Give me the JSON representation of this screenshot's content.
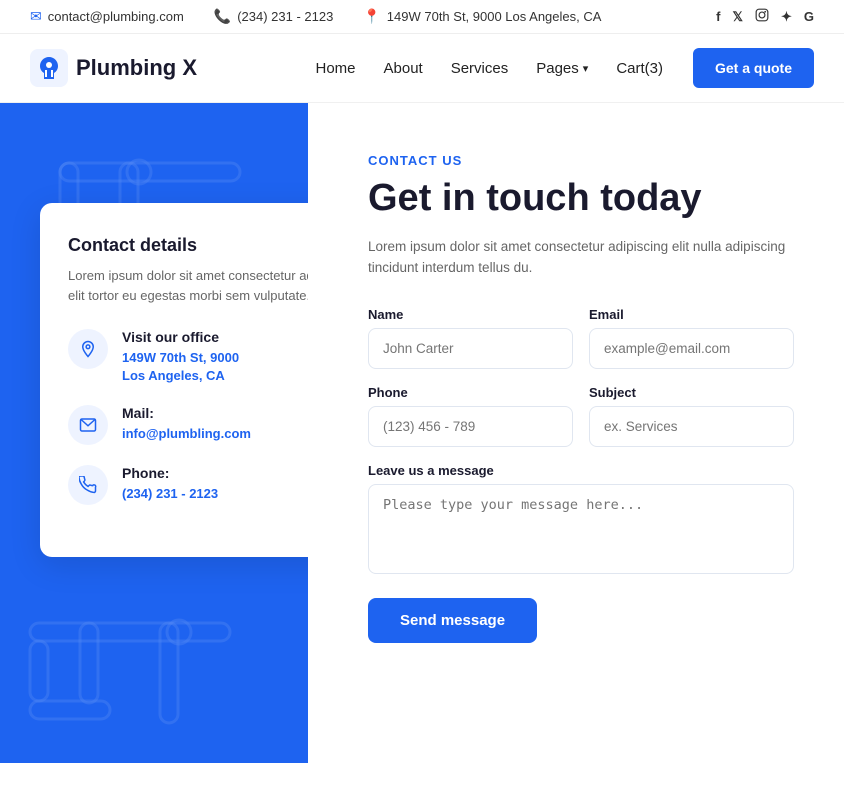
{
  "topbar": {
    "email": "contact@plumbing.com",
    "phone": "(234) 231 - 2123",
    "address": "149W 70th St, 9000 Los Angeles, CA",
    "socials": [
      "f",
      "𝕏",
      "📷",
      "✦",
      "G"
    ]
  },
  "navbar": {
    "logo_text": "Plumbing X",
    "links": [
      "Home",
      "About",
      "Services"
    ],
    "dropdown_label": "Pages",
    "cart_label": "Cart(3)",
    "cta_label": "Get a quote"
  },
  "contact_card": {
    "title": "Contact details",
    "description": "Lorem ipsum dolor sit amet consectetur adipisc elit tortor eu egestas morbi sem vulputate.",
    "office_label": "Visit our office",
    "office_value": "149W 70th St, 9000\nLos Angeles, CA",
    "mail_label": "Mail:",
    "mail_value": "info@plumbling.com",
    "phone_label": "Phone:",
    "phone_value": "(234) 231 - 2123"
  },
  "form_section": {
    "section_label": "CONTACT US",
    "title": "Get in touch today",
    "description": "Lorem ipsum dolor sit amet consectetur adipiscing elit nulla adipiscing tincidunt interdum tellus du.",
    "name_label": "Name",
    "name_placeholder": "John Carter",
    "email_label": "Email",
    "email_placeholder": "example@email.com",
    "phone_label": "Phone",
    "phone_placeholder": "(123) 456 - 789",
    "subject_label": "Subject",
    "subject_placeholder": "ex. Services",
    "message_label": "Leave us a message",
    "message_placeholder": "Please type your message here...",
    "send_label": "Send message"
  }
}
